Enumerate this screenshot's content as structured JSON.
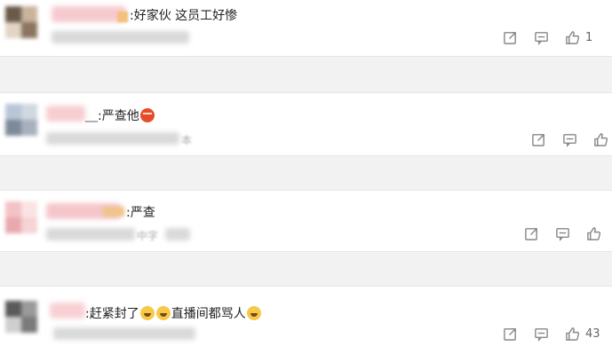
{
  "comments": [
    {
      "text": ":好家伙 这员工好惨",
      "like_count": "1"
    },
    {
      "prefix": "__",
      "text": ":严查他",
      "like_count": "",
      "meta_tail": "本"
    },
    {
      "text": ":严查",
      "like_count": "",
      "meta_tail": "中字"
    },
    {
      "text_part1": ":赶紧封了",
      "text_part2": "直播间都骂人",
      "like_count": "43"
    }
  ],
  "icons": {
    "share": "share-icon",
    "comment": "comment-icon",
    "like": "thumbs-up-icon",
    "angry_emoji": "angry-face-emoji",
    "cry_emoji": "crying-laugh-emoji"
  },
  "colors": {
    "background": "#f2f2f2",
    "card": "#ffffff",
    "text": "#222222",
    "icon": "#888888"
  }
}
